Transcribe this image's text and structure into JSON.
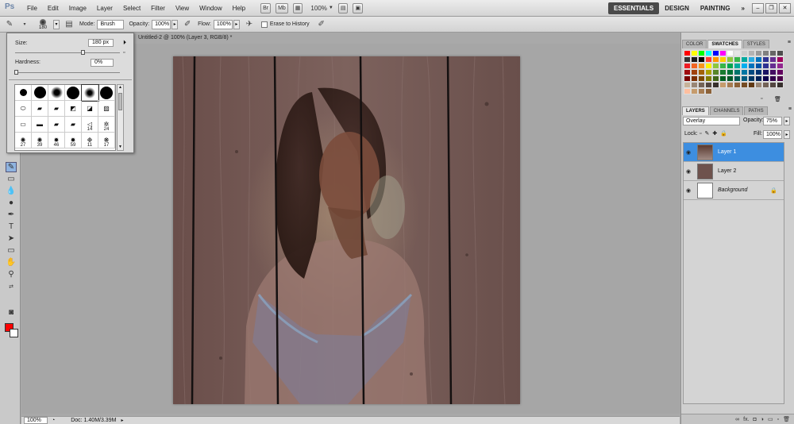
{
  "app": {
    "logo": "Ps",
    "menus": [
      "File",
      "Edit",
      "Image",
      "Layer",
      "Select",
      "Filter",
      "View",
      "Window",
      "Help"
    ],
    "bridge_label": "Br",
    "mini_bridge_label": "Mb",
    "zoom": "100%",
    "workspaces": [
      "ESSENTIALS",
      "DESIGN",
      "PAINTING"
    ],
    "more": "»"
  },
  "options": {
    "brush_size": "180",
    "mode_label": "Mode:",
    "mode_value": "Brush",
    "opacity_label": "Opacity:",
    "opacity_value": "100%",
    "flow_label": "Flow:",
    "flow_value": "100%",
    "erase_history_label": "Erase to History"
  },
  "brush_picker": {
    "size_label": "Size:",
    "size_value": "180 px",
    "hardness_label": "Hardness:",
    "hardness_value": "0%",
    "hardness_level": 0,
    "size_level": 0.65,
    "brush_numbers": [
      "",
      "",
      "",
      "",
      "",
      "",
      "",
      "",
      "",
      "",
      "",
      "",
      "",
      "",
      "",
      "",
      "14",
      "24",
      "27",
      "39",
      "46",
      "59",
      "11",
      "17"
    ]
  },
  "document": {
    "tab_title": "Untitled-2 @ 100% (Layer 3, RGB/8) *",
    "status_zoom": "100%",
    "status_doc": "Doc: 1.40M/3.39M"
  },
  "panels": {
    "top_tabs": [
      "COLOR",
      "SWATCHES",
      "STYLES"
    ],
    "layer_tabs": [
      "LAYERS",
      "CHANNELS",
      "PATHS"
    ],
    "blend_mode": "Overlay",
    "opacity_label": "Opacity:",
    "opacity_value": "75%",
    "lock_label": "Lock:",
    "fill_label": "Fill:",
    "fill_value": "100%",
    "layers": [
      {
        "name": "Layer 1",
        "active": true
      },
      {
        "name": "Layer 2",
        "active": false
      },
      {
        "name": "Background",
        "active": false
      }
    ],
    "footer_fx": "fx."
  },
  "colors": {
    "foreground": "#ff0000",
    "background": "#ffffff",
    "selection": "#3d8ee0"
  }
}
